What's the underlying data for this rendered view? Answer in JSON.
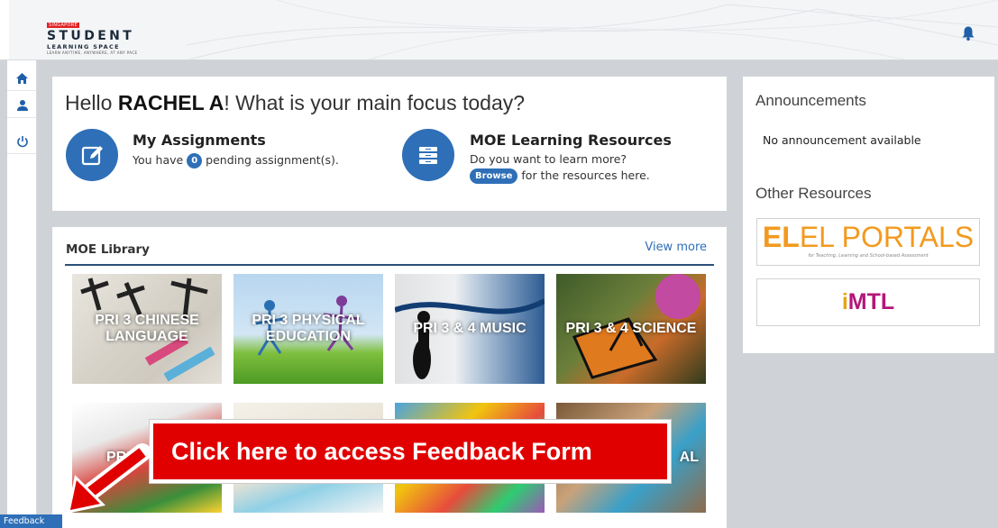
{
  "header": {
    "logo_country": "SINGAPORE",
    "logo_line1": "STUDENT",
    "logo_line2": "LEARNING SPACE",
    "logo_tagline": "LEARN ANYTIME, ANYWHERE, AT ANY PACE"
  },
  "greeting": {
    "prefix": "Hello ",
    "name": "RACHEL A",
    "suffix": "! What is your main focus today?"
  },
  "assignments": {
    "title": "My Assignments",
    "text_before": "You have",
    "count": "0",
    "text_after": "pending assignment(s)."
  },
  "moe_resources": {
    "title": "MOE Learning Resources",
    "line1": "Do you want to learn more?",
    "browse_label": "Browse",
    "line2_after": "for the resources here."
  },
  "library": {
    "title": "MOE Library",
    "view_more": "View more",
    "tiles": [
      {
        "label": "PRI 3 CHINESE LANGUAGE"
      },
      {
        "label": "PRI 3 PHYSICAL EDUCATION"
      },
      {
        "label": "PRI 3 & 4 MUSIC"
      },
      {
        "label": "PRI 3 & 4 SCIENCE"
      },
      {
        "label": "PRI"
      },
      {
        "label": ""
      },
      {
        "label": ""
      },
      {
        "label": "AL"
      }
    ]
  },
  "sidebar_right": {
    "announcements_title": "Announcements",
    "no_announcement": "No announcement available",
    "other_resources_title": "Other Resources",
    "el_portals": {
      "main": "EL PORTALS",
      "sub": "for Teaching, Learning and School-based Assessment"
    },
    "mtl": {
      "label": "MTL"
    }
  },
  "callout": {
    "text": "Click here to access Feedback Form"
  },
  "feedback_tab": {
    "label": "Feedback"
  },
  "colors": {
    "primary": "#2e6fb7",
    "callout": "#e00000",
    "background": "#cfd2d6"
  }
}
